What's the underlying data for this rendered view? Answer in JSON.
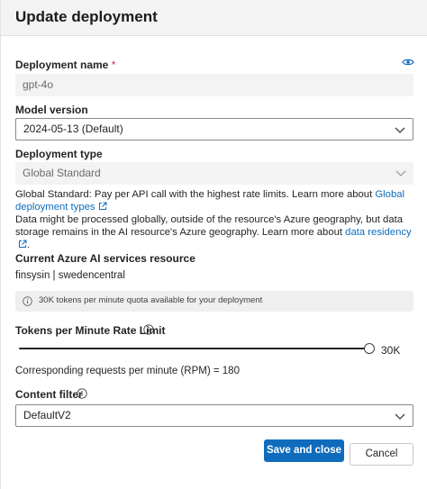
{
  "dialog": {
    "title": "Update deployment"
  },
  "deployment_name": {
    "label": "Deployment name",
    "required_mark": "*",
    "value": "gpt-4o"
  },
  "model_version": {
    "label": "Model version",
    "value": "2024-05-13 (Default)"
  },
  "deployment_type": {
    "label": "Deployment type",
    "value": "Global Standard",
    "desc_part1": "Global Standard: Pay per API call with the highest rate limits. Learn more about ",
    "desc_link1": "Global deployment types",
    "desc_part2": "Data might be processed globally, outside of the resource's Azure geography, but data storage remains in the AI resource's Azure geography. Learn more about ",
    "desc_link2": "data residency",
    "desc_end": "."
  },
  "resource": {
    "label": "Current Azure AI services resource",
    "value": "finsysin | swedencentral"
  },
  "quota_info": {
    "text": "30K tokens per minute quota available for your deployment"
  },
  "rate_limit": {
    "label": "Tokens per Minute Rate Limit",
    "value_label": "30K",
    "fraction": 1.0,
    "rpm_text": "Corresponding requests per minute (RPM) = 180"
  },
  "content_filter": {
    "label": "Content filter",
    "value": "DefaultV2"
  },
  "actions": {
    "save_label": "Save and close",
    "cancel_label": "Cancel"
  },
  "icons": {
    "eye": "eye-icon",
    "chevron": "chevron-down-icon",
    "external": "external-link-icon",
    "info": "info-icon"
  },
  "colors": {
    "accent": "#0f6cbd",
    "required": "#c4314b"
  }
}
